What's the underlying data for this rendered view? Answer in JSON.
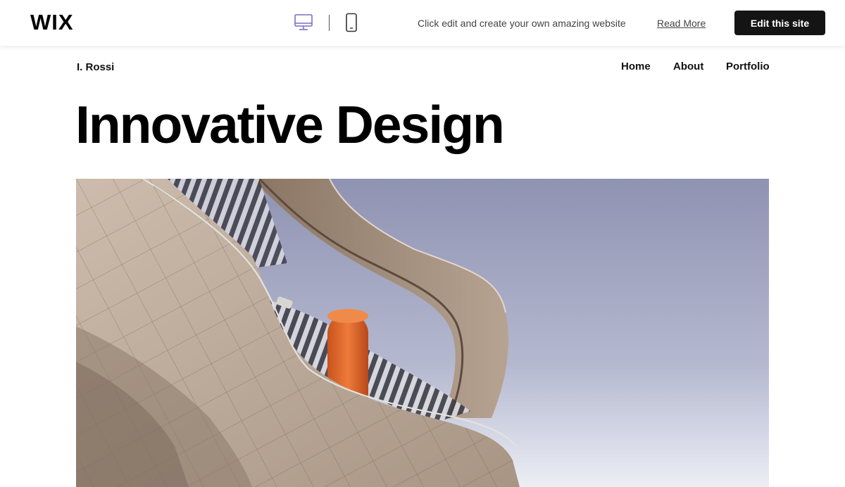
{
  "wix_bar": {
    "logo": "WIX",
    "promo_text": "Click edit and create your own amazing website",
    "read_more": "Read More",
    "edit_button": "Edit this site",
    "device_icons": [
      "desktop-icon",
      "mobile-icon"
    ]
  },
  "site": {
    "name": "I. Rossi",
    "nav": [
      "Home",
      "About",
      "Portfolio"
    ],
    "hero_title": "Innovative Design",
    "hero_image": "modern-architecture-photo"
  },
  "colors": {
    "button_bg": "#141414",
    "sky": "#9ea3bf",
    "facade": "#c4b3a4",
    "accent_orange": "#e06a2c"
  }
}
